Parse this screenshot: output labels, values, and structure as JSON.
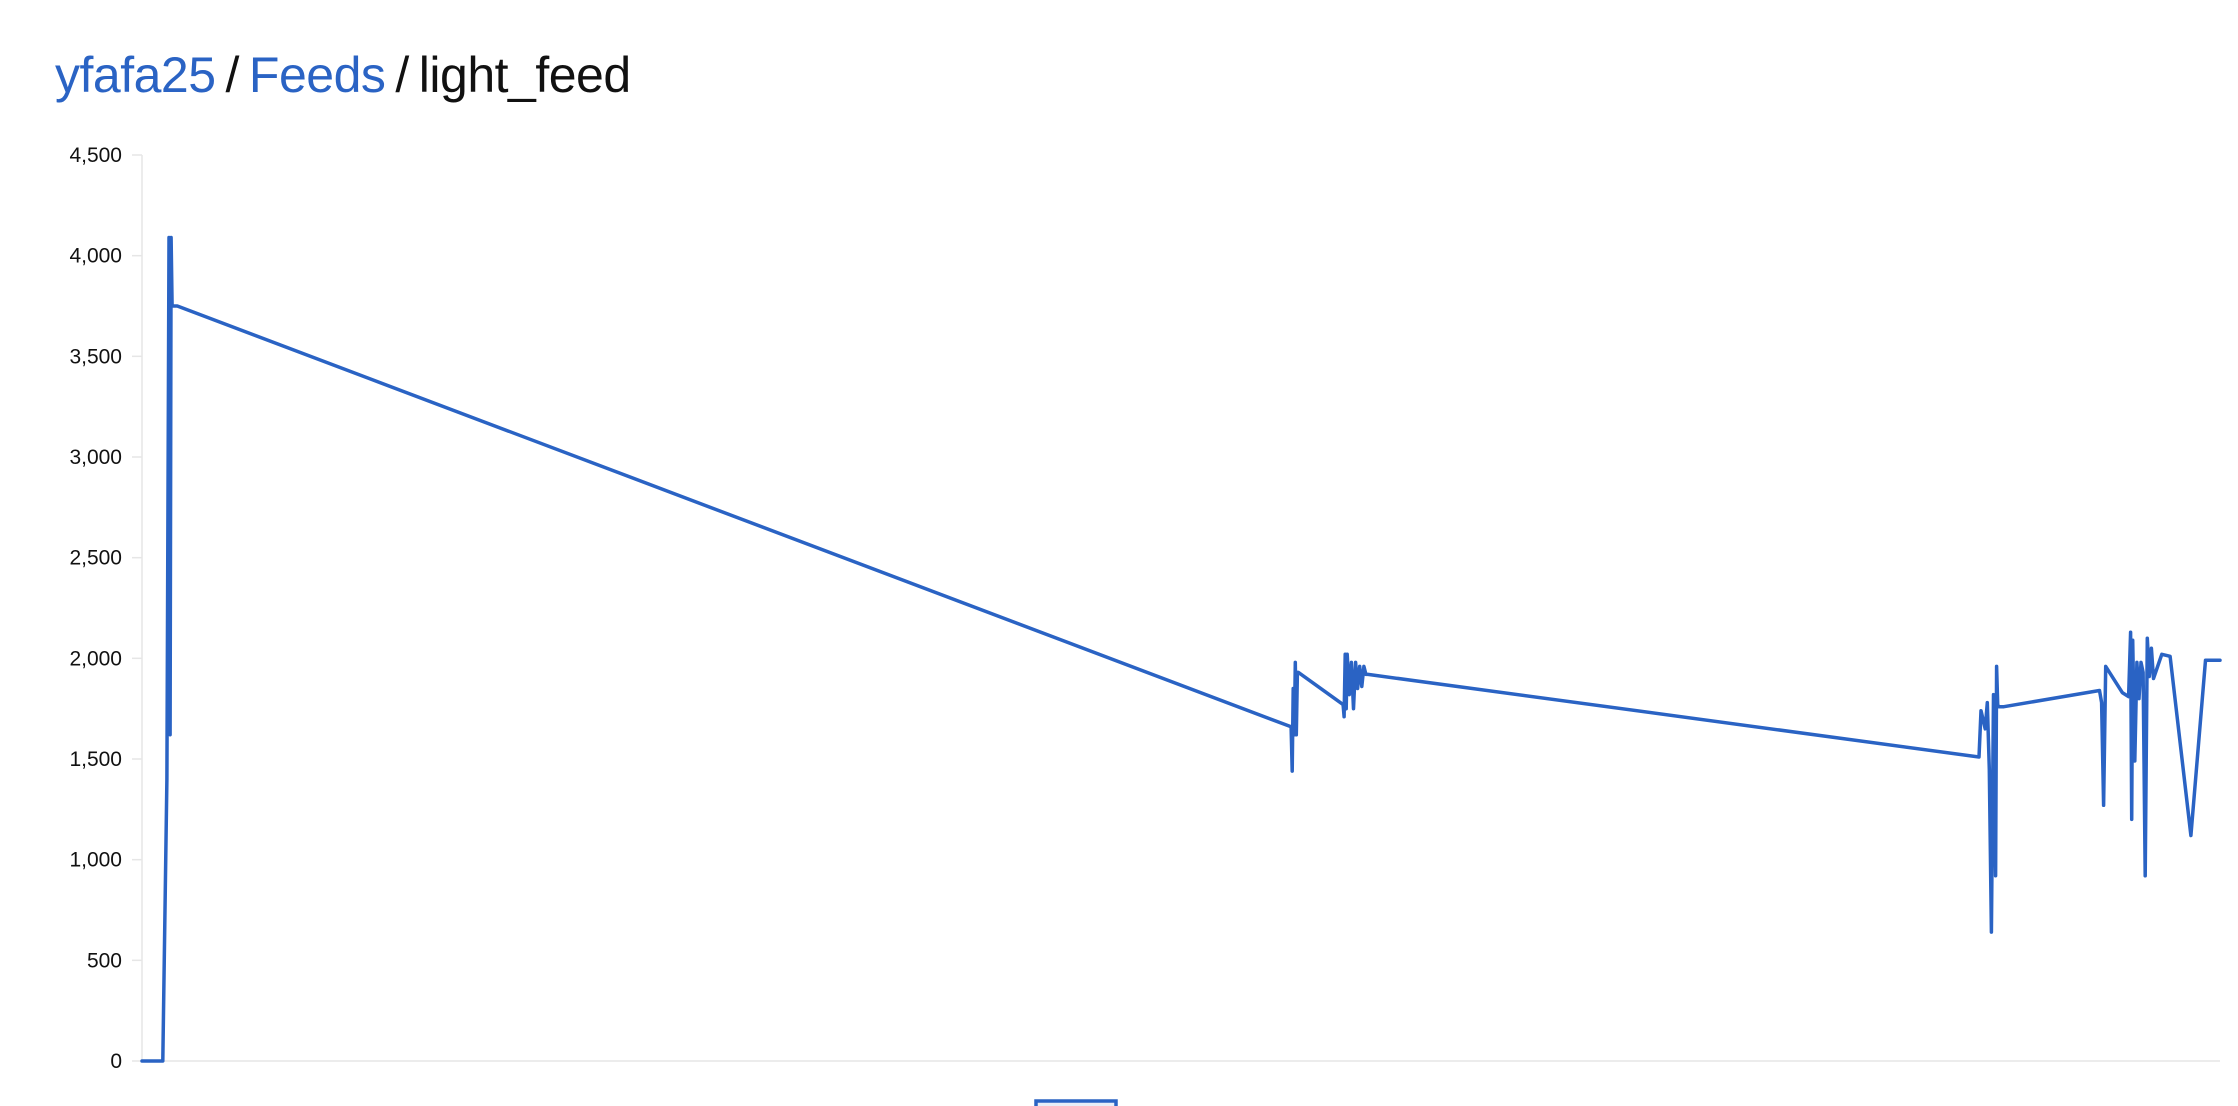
{
  "breadcrumb": {
    "user": "yfafa25",
    "separator": "/",
    "feeds": "Feeds",
    "current": "light_feed"
  },
  "colors": {
    "accent": "#2a63c4",
    "line": "#2a63c4",
    "axis": "#e6e6e6",
    "text": "#111111"
  },
  "chart_data": {
    "type": "line",
    "title": "",
    "xlabel": "",
    "ylabel": "",
    "ylim": [
      0,
      4500
    ],
    "yticks": [
      0,
      500,
      1000,
      1500,
      2000,
      2500,
      3000,
      3500,
      4000,
      4500
    ],
    "ytick_labels": [
      "0",
      "500",
      "1,000",
      "1,500",
      "2,000",
      "2,500",
      "3,000",
      "3,500",
      "4,000",
      "4,500"
    ],
    "grid": false,
    "legend": "bottom-center",
    "series": [
      {
        "name": "light_feed",
        "x": [
          0,
          1,
          1.2,
          1.3,
          1.35,
          1.4,
          1.45,
          1.5,
          1.55,
          1.6,
          1.65,
          1.7,
          55.3,
          55.35,
          55.4,
          55.45,
          55.5,
          55.55,
          55.6,
          55.65,
          57.8,
          57.85,
          57.9,
          57.95,
          58.0,
          58.1,
          58.2,
          58.3,
          58.4,
          58.5,
          58.6,
          58.7,
          58.8,
          58.9,
          59.0,
          88.4,
          88.5,
          88.7,
          88.8,
          88.9,
          89.0,
          89.1,
          89.2,
          89.25,
          89.3,
          89.35,
          89.4,
          89.5,
          89.6,
          94.2,
          94.3,
          94.4,
          94.5,
          95.3,
          95.6,
          95.7,
          95.75,
          95.8,
          95.9,
          96.0,
          96.1,
          96.2,
          96.3,
          96.4,
          96.5,
          96.6,
          96.7,
          96.8,
          97.2,
          97.6,
          98.6,
          99.3,
          100
        ],
        "values": [
          0,
          0,
          1400,
          4090,
          1620,
          4090,
          3750,
          3750,
          3750,
          3750,
          3750,
          3750,
          1660,
          1440,
          1850,
          1620,
          1980,
          1620,
          1930,
          1930,
          1770,
          1710,
          2020,
          1750,
          2020,
          1820,
          1980,
          1750,
          1980,
          1850,
          1960,
          1860,
          1960,
          1920,
          1920,
          1510,
          1740,
          1650,
          1780,
          1450,
          640,
          1820,
          920,
          1960,
          1770,
          1760,
          1760,
          1760,
          1760,
          1840,
          1780,
          1270,
          1960,
          1830,
          1810,
          2130,
          1200,
          2090,
          1490,
          1980,
          1800,
          1980,
          1930,
          920,
          2100,
          1910,
          2050,
          1900,
          2020,
          2010,
          1120,
          1990,
          1990
        ]
      }
    ]
  }
}
